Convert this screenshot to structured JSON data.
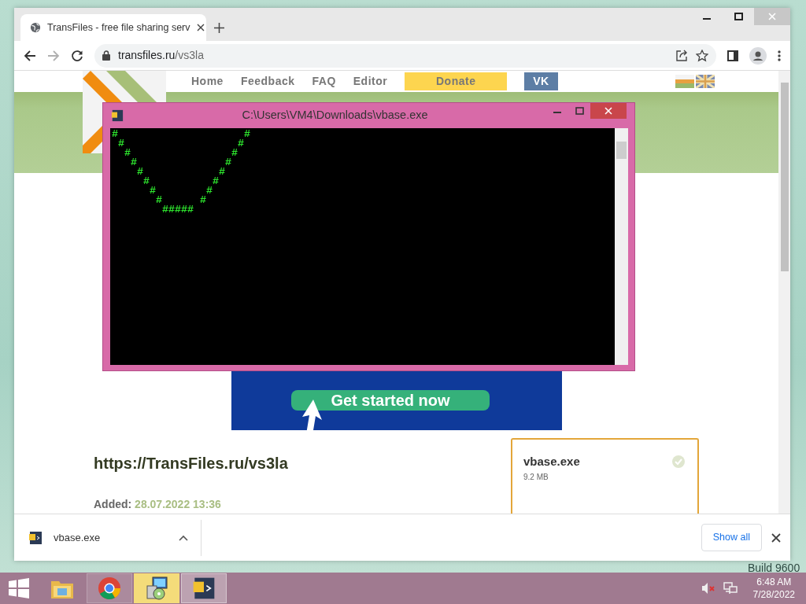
{
  "browser": {
    "tab": {
      "title": "TransFiles - free file sharing serv",
      "selected": true
    },
    "address": {
      "domain": "transfiles.ru",
      "path": "/vs3la"
    }
  },
  "site": {
    "nav": [
      {
        "label": "Home",
        "kind": "link"
      },
      {
        "label": "Feedback",
        "kind": "link"
      },
      {
        "label": "FAQ",
        "kind": "link"
      },
      {
        "label": "Editor",
        "kind": "link"
      },
      {
        "label": "Donate",
        "kind": "donate"
      },
      {
        "label": "VK",
        "kind": "social"
      }
    ],
    "ad": {
      "button": "Get started now"
    },
    "link_title": "https://TransFiles.ru/vs3la",
    "added": {
      "label": "Added:",
      "value": "28.07.2022 13:36"
    },
    "file_card": {
      "name": "vbase.exe",
      "size": "9.2 MB"
    }
  },
  "console": {
    "title": "C:\\Users\\VM4\\Downloads\\vbase.exe",
    "lines": [
      "#                    #",
      " #                  #",
      "  #                #",
      "   #              #",
      "    #            #",
      "     #          #",
      "      #        #",
      "       #      #",
      "        #####"
    ]
  },
  "download_bar": {
    "file": "vbase.exe",
    "button": "Show all"
  },
  "desktop": {
    "build_text": "Build 9600"
  },
  "taskbar": {
    "apps": [
      {
        "kind": "explorer",
        "running": false,
        "highlighted": false,
        "selected": false
      },
      {
        "kind": "chrome",
        "running": true,
        "highlighted": false,
        "selected": false
      },
      {
        "kind": "installer",
        "running": true,
        "highlighted": true,
        "selected": false
      },
      {
        "kind": "console",
        "running": true,
        "highlighted": false,
        "selected": true
      }
    ],
    "clock": {
      "time": "6:48 AM",
      "date": "7/28/2022"
    }
  }
}
